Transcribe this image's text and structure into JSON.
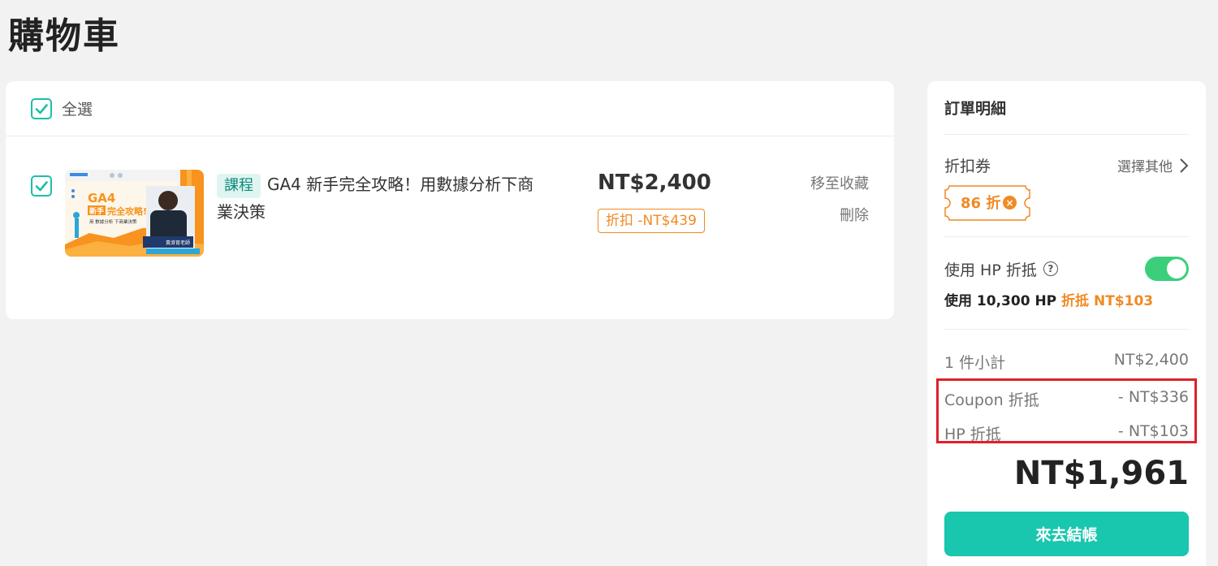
{
  "page": {
    "title": "購物車"
  },
  "cart": {
    "select_all_label": "全選",
    "items": [
      {
        "tag": "課程",
        "title": "GA4 新手完全攻略！用數據分析下商業決策",
        "price": "NT$2,400",
        "discount": "折扣 -NT$439",
        "move_to_favorites": "移至收藏",
        "remove": "刪除",
        "thumbnail": {
          "headline": "GA4",
          "badge": "新手",
          "headline_rest": "完全攻略!",
          "subline": "用 數據分析 下商業決策",
          "teacher": "黃濟育老師"
        }
      }
    ]
  },
  "summary": {
    "title": "訂單明細",
    "coupon_label": "折扣券",
    "choose_other": "選擇其他",
    "coupon_value": "86 折",
    "hp_label": "使用 HP 折抵",
    "hp_enabled": true,
    "hp_usage_prefix": "使用 10,300 HP",
    "hp_usage_accent": "折抵 NT$103",
    "subtotal_label": "1 件小計",
    "subtotal_value": "NT$2,400",
    "coupon_discount_label": "Coupon 折抵",
    "coupon_discount_value": "- NT$336",
    "hp_discount_label": "HP 折抵",
    "hp_discount_value": "- NT$103",
    "total": "NT$1,961",
    "checkout_label": "來去結帳"
  },
  "colors": {
    "accent": "#18c7ae",
    "orange": "#f08a24",
    "highlight": "#e0202a",
    "toggle": "#3ccf7b"
  }
}
